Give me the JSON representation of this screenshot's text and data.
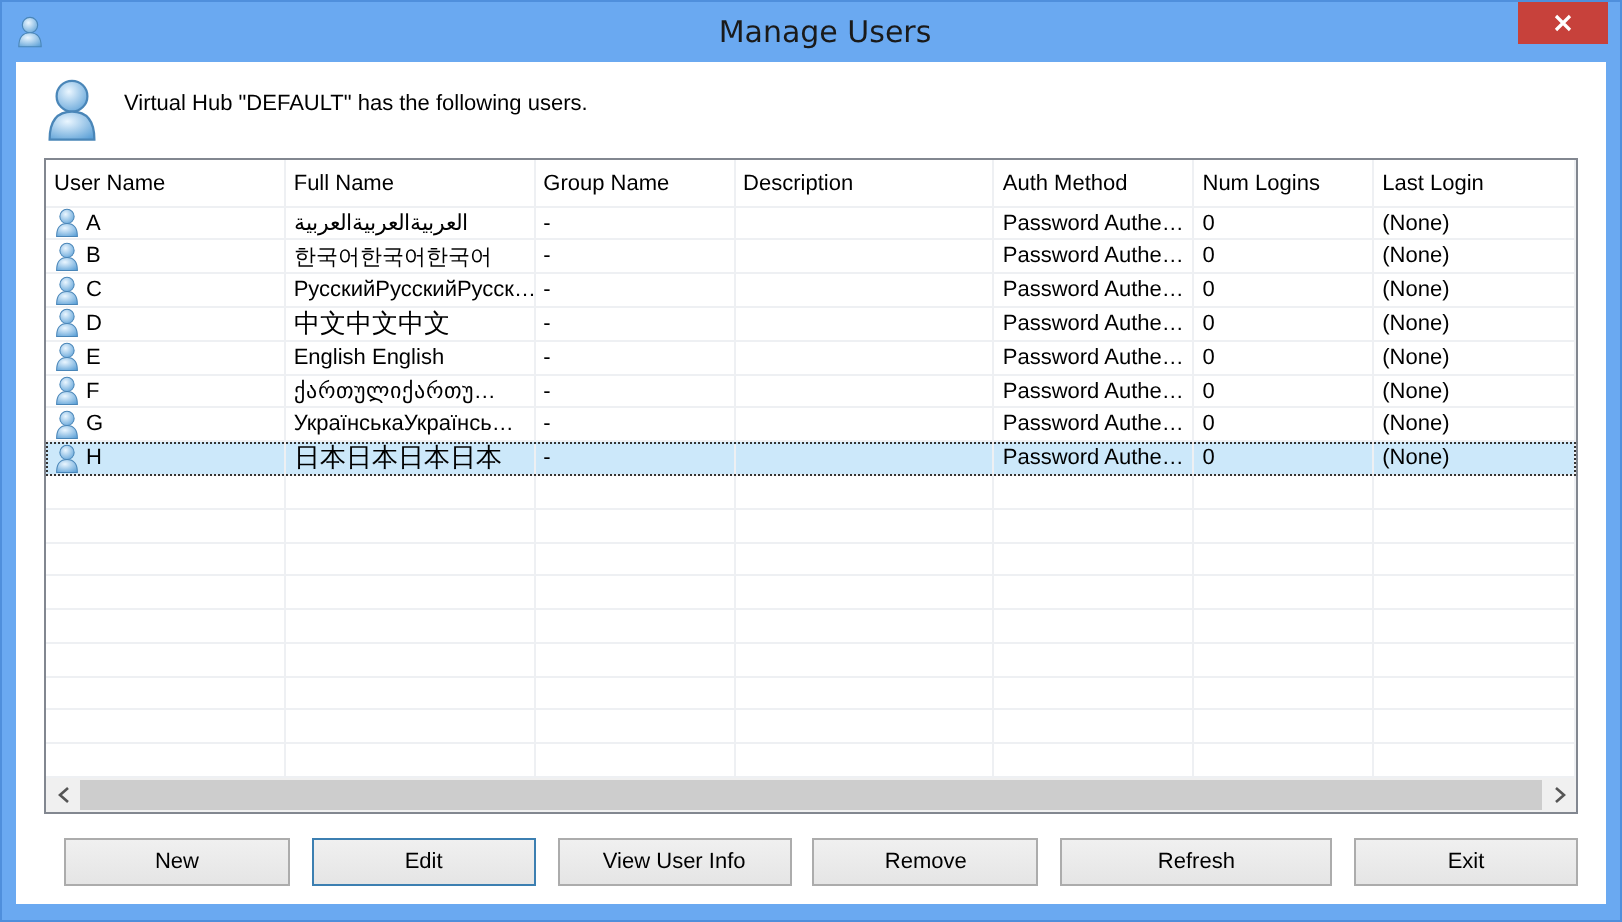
{
  "window": {
    "title": "Manage Users"
  },
  "message": "Virtual Hub \"DEFAULT\" has the following users.",
  "table": {
    "columns": [
      "User Name",
      "Full Name",
      "Group Name",
      "Description",
      "Auth Method",
      "Num Logins",
      "Last Login"
    ],
    "rows": [
      {
        "selected": false,
        "cells": [
          "A",
          "العربيةالعربيةالعربية",
          "-",
          "",
          "Password Authe…",
          "0",
          "(None)"
        ]
      },
      {
        "selected": false,
        "cells": [
          "B",
          "한국어한국어한국어",
          "-",
          "",
          "Password Authe…",
          "0",
          "(None)"
        ]
      },
      {
        "selected": false,
        "cells": [
          "C",
          "РусскийРусскийРусск…",
          "-",
          "",
          "Password Authe…",
          "0",
          "(None)"
        ]
      },
      {
        "selected": false,
        "cells": [
          "D",
          "中文中文中文",
          "-",
          "",
          "Password Authe…",
          "0",
          "(None)"
        ]
      },
      {
        "selected": false,
        "cells": [
          "E",
          "English English",
          "-",
          "",
          "Password Authe…",
          "0",
          "(None)"
        ]
      },
      {
        "selected": false,
        "cells": [
          "F",
          "ქართულიქართუ…",
          "-",
          "",
          "Password Authe…",
          "0",
          "(None)"
        ]
      },
      {
        "selected": false,
        "cells": [
          "G",
          "УкраїнськаУкраїнсь…",
          "-",
          "",
          "Password Authe…",
          "0",
          "(None)"
        ]
      },
      {
        "selected": true,
        "cells": [
          "H",
          "日本日本日本日本",
          "-",
          "",
          "Password Authe…",
          "0",
          "(None)"
        ]
      }
    ]
  },
  "buttons": [
    {
      "label": "New",
      "default": false
    },
    {
      "label": "Edit",
      "default": true
    },
    {
      "label": "View User Info",
      "default": false
    },
    {
      "label": "Remove",
      "default": false
    },
    {
      "label": "Refresh",
      "default": false
    },
    {
      "label": "Exit",
      "default": false
    }
  ]
}
